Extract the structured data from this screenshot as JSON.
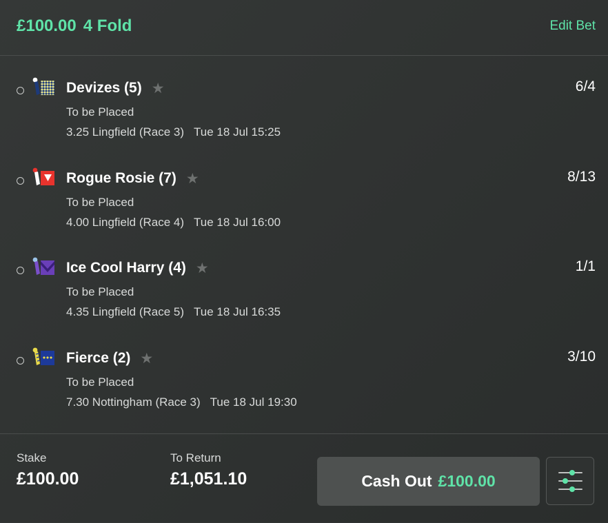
{
  "header": {
    "stake_label": "£100.00",
    "bet_type": "4 Fold",
    "edit_label": "Edit Bet"
  },
  "selections": [
    {
      "name": "Devizes (5)",
      "market": "To be Placed",
      "event": "3.25 Lingfield (Race 3)",
      "time": "Tue 18 Jul 15:25",
      "odds": "6/4",
      "silk_icon": "jockey-silk-navy-yellow-diamonds-icon"
    },
    {
      "name": "Rogue Rosie (7)",
      "market": "To be Placed",
      "event": "4.00 Lingfield (Race 4)",
      "time": "Tue 18 Jul 16:00",
      "odds": "8/13",
      "silk_icon": "jockey-silk-red-white-triangle-icon"
    },
    {
      "name": "Ice Cool Harry (4)",
      "market": "To be Placed",
      "event": "4.35 Lingfield (Race 5)",
      "time": "Tue 18 Jul 16:35",
      "odds": "1/1",
      "silk_icon": "jockey-silk-purple-chevron-icon"
    },
    {
      "name": "Fierce (2)",
      "market": "To be Placed",
      "event": "7.30 Nottingham (Race 3)",
      "time": "Tue 18 Jul 19:30",
      "odds": "3/10",
      "silk_icon": "jockey-silk-blue-yellow-diamonds-icon"
    }
  ],
  "footer": {
    "stake_label": "Stake",
    "stake_value": "£100.00",
    "return_label": "To Return",
    "return_value": "£1,051.10",
    "cashout_label": "Cash Out",
    "cashout_value": "£100.00",
    "settings_icon": "sliders-icon"
  },
  "colors": {
    "accent": "#5fe3a8",
    "background": "#333635",
    "button": "#4e5150"
  }
}
